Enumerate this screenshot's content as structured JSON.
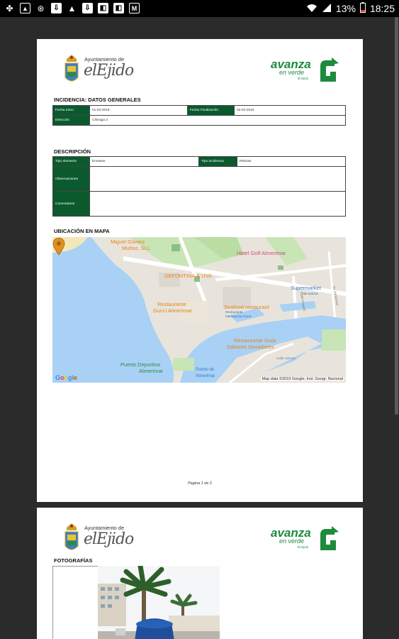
{
  "status_bar": {
    "battery": "13%",
    "time": "18:25"
  },
  "document": {
    "header": {
      "ayuntamiento": "Ayuntamiento de",
      "town_script": "elEjido",
      "brand": "avanza",
      "brand_sub": "en verde",
      "brand_tiny": "El Ejido"
    },
    "incidencia": {
      "title": "INCIDENCIA: DATOS GENERALES",
      "fecha_inicio_label": "Fecha Inicio",
      "fecha_inicio": "01-04-2019",
      "fecha_finalizacion_label": "Fecha Finalización",
      "fecha_finalizacion": "02-04-2019",
      "direccion_label": "Dirección",
      "direccion": "C/Draga 3"
    },
    "descripcion": {
      "title": "DESCRIPCIÓN",
      "tipo_elemento_label": "Tipo elemento",
      "tipo_elemento": "Envases",
      "tipo_incidencia_label": "Tipo incidencia",
      "tipo_incidencia": "Rebose",
      "observaciones_label": "Observaciones",
      "comentarios_label": "Comentarios"
    },
    "mapa": {
      "title": "UBICACIÓN EN MAPA",
      "labels": {
        "miguel": "Miguel Gómez",
        "miguel2": "Muñoz, SLL",
        "hotel": "Hotel Golf Almerimar",
        "defontina": "DEFONTINA & UVA",
        "supermarket": "Supermarket",
        "supermarket2": "Mercadona",
        "restaurante": "Restaurante",
        "restaurante2": "Gucci Almerimar",
        "seafood": "Seafood restaurant",
        "seafood2": "Restaurante",
        "seafood3": "Marisqueria Fuera",
        "guia": "Restaurante Guía",
        "guia2": "Sabores Senadores",
        "puerto": "Puerto Deportivo",
        "puerto2": "Almerimar",
        "puerto_de": "Puerto de",
        "puerto_de2": "Almerimar",
        "calle_fragata": "Calle Fragata",
        "calle_cancus": "Calle Cancus",
        "av_almerimar": "Av. Almerimar",
        "google": "Google",
        "attribution": "Map data ©2019 Google, Inst. Geogr. Nacional"
      }
    },
    "footer": "Pagina 1 de 2",
    "page2": {
      "fotografias_title": "FOTOGRAFÍAS"
    }
  }
}
